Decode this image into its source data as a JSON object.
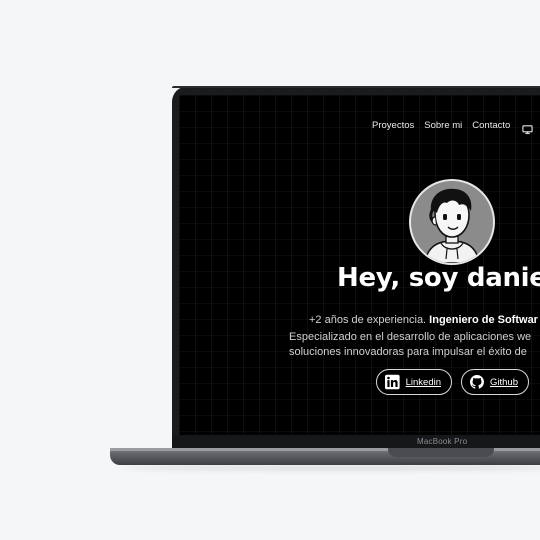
{
  "nav": {
    "items": [
      "Proyectos",
      "Sobre mi",
      "Contacto"
    ],
    "theme_icon": "monitor-icon"
  },
  "hero": {
    "title": "Hey, soy daniel",
    "line1_prefix": "+2 años de experiencia. ",
    "line1_bold": "Ingeniero de Softwar",
    "line2": "Especializado en el desarrollo de aplicaciones we",
    "line3": "soluciones innovadoras para impulsar el éxito de"
  },
  "buttons": {
    "linkedin": "Linkedin",
    "github": "Github"
  },
  "device": {
    "model": "MacBook Pro"
  },
  "colors": {
    "screen_bg": "#000000",
    "text": "#ffffff",
    "avatar_bg": "#8b8b8b"
  }
}
